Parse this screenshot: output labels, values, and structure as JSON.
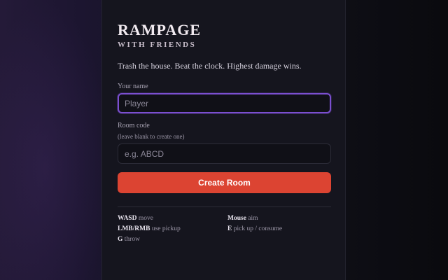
{
  "header": {
    "title": "RAMPAGE",
    "subtitle": "WITH FRIENDS",
    "tagline": "Trash the house. Beat the clock. Highest damage wins."
  },
  "form": {
    "name_label": "Your name",
    "name_placeholder": "Player",
    "room_label": "Room code",
    "room_hint": "(leave blank to create one)",
    "room_placeholder": "e.g. ABCD",
    "submit_label": "Create Room"
  },
  "controls": [
    {
      "key": "WASD",
      "action": "move"
    },
    {
      "key": "Mouse",
      "action": "aim"
    },
    {
      "key": "LMB/RMB",
      "action": "use pickup"
    },
    {
      "key": "E",
      "action": "pick up / consume"
    },
    {
      "key": "G",
      "action": "throw"
    }
  ],
  "colors": {
    "accent_button": "#dc4432",
    "focus_ring": "#7b4fd0",
    "panel_bg": "#15151e"
  }
}
